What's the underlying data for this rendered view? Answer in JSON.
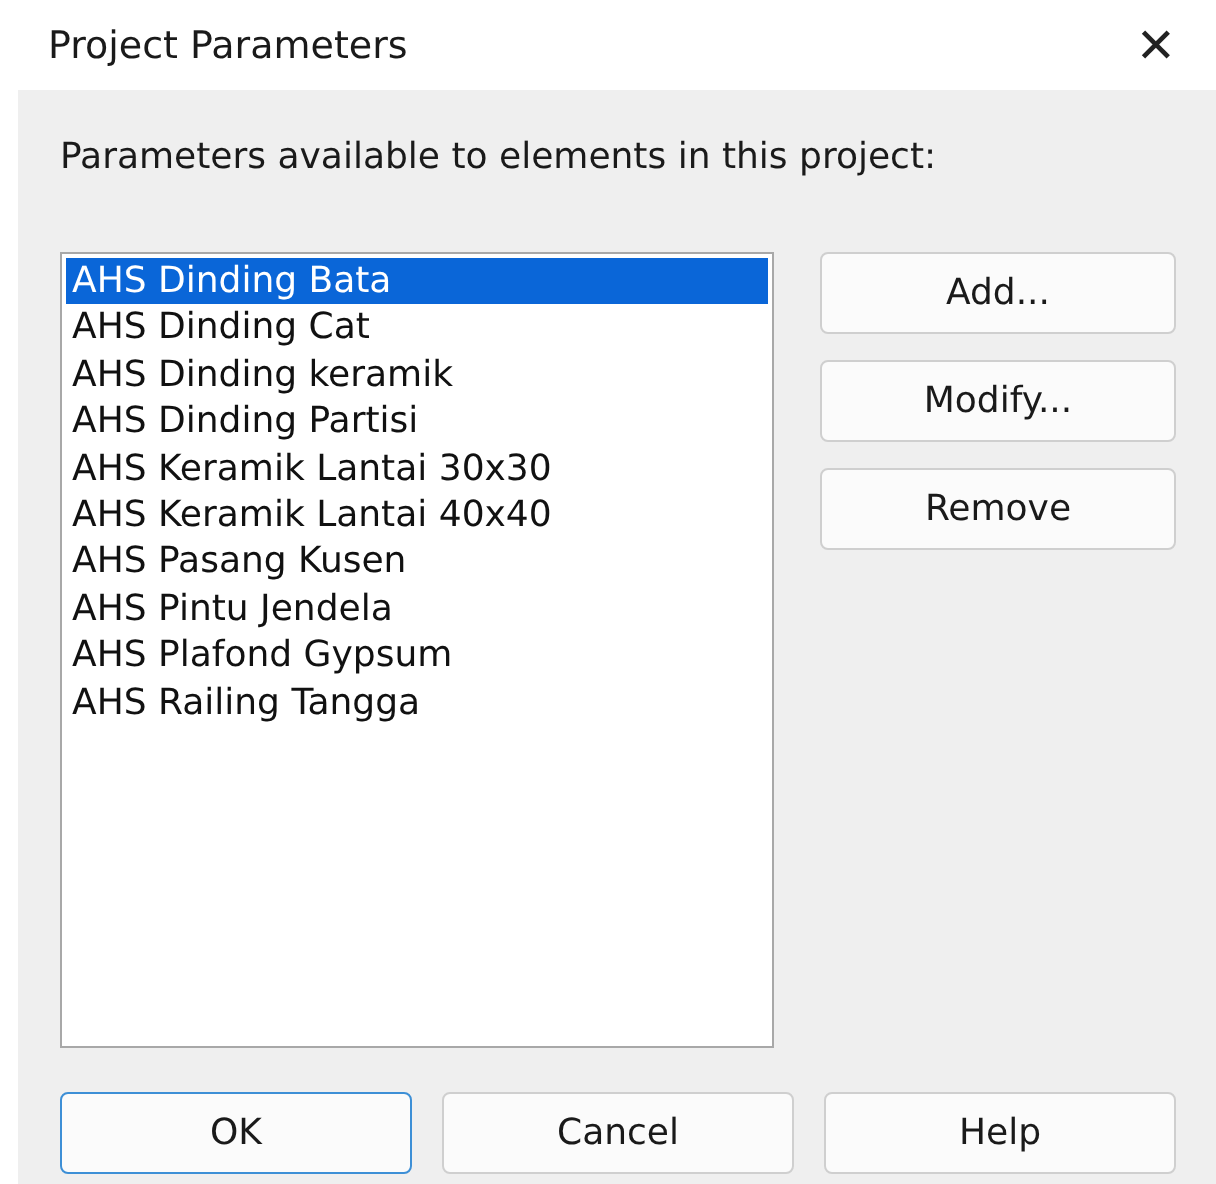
{
  "window": {
    "title": "Project Parameters",
    "close": "✕"
  },
  "caption": "Parameters available to elements in this project:",
  "parameters": [
    {
      "label": "AHS Dinding Bata",
      "selected": true
    },
    {
      "label": "AHS Dinding Cat",
      "selected": false
    },
    {
      "label": "AHS Dinding keramik",
      "selected": false
    },
    {
      "label": "AHS Dinding Partisi",
      "selected": false
    },
    {
      "label": "AHS Keramik Lantai 30x30",
      "selected": false
    },
    {
      "label": "AHS Keramik Lantai 40x40",
      "selected": false
    },
    {
      "label": "AHS Pasang Kusen",
      "selected": false
    },
    {
      "label": "AHS Pintu Jendela",
      "selected": false
    },
    {
      "label": "AHS Plafond Gypsum",
      "selected": false
    },
    {
      "label": "AHS Railing Tangga",
      "selected": false
    }
  ],
  "side_buttons": [
    "Add...",
    "Modify...",
    "Remove"
  ],
  "footer_buttons": [
    {
      "label": "OK",
      "default": true
    },
    {
      "label": "Cancel",
      "default": false
    },
    {
      "label": "Help",
      "default": false
    }
  ]
}
